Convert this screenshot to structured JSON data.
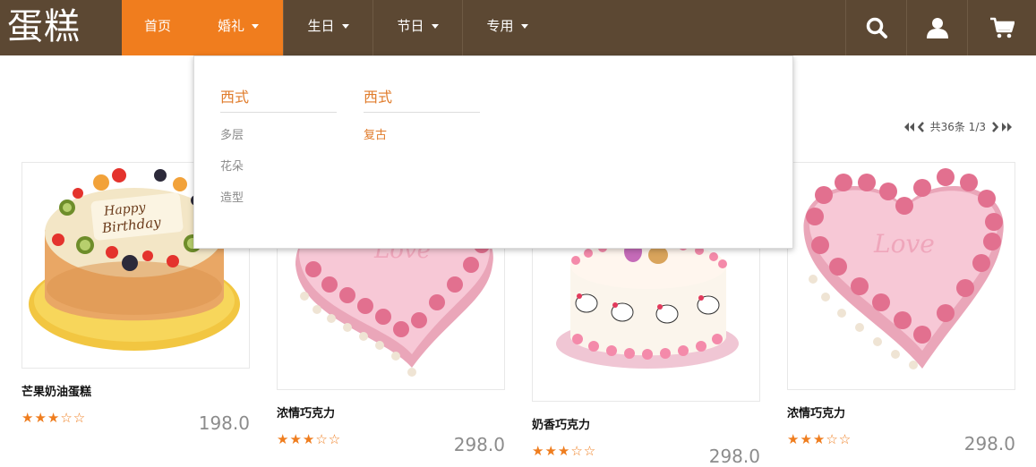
{
  "brand": {
    "logo": "蛋糕"
  },
  "nav": {
    "items": [
      {
        "label": "首页"
      },
      {
        "label": "婚礼"
      },
      {
        "label": "生日"
      },
      {
        "label": "节日"
      },
      {
        "label": "专用"
      }
    ],
    "icons": [
      "search-icon",
      "user-icon",
      "cart-icon"
    ]
  },
  "dropdown": {
    "columns": [
      {
        "heading": "西式",
        "items": [
          "多层",
          "花朵",
          "造型"
        ]
      },
      {
        "heading": "西式",
        "items": [
          "复古"
        ]
      }
    ]
  },
  "pager": {
    "text": "共36条 1/3"
  },
  "products": [
    {
      "name": "芒果奶油蛋糕",
      "price": "198.0",
      "rating": 3
    },
    {
      "name": "浓情巧克力",
      "price": "298.0",
      "rating": 3
    },
    {
      "name": "奶香巧克力",
      "price": "298.0",
      "rating": 3
    },
    {
      "name": "浓情巧克力",
      "price": "298.0",
      "rating": 3
    }
  ],
  "colors": {
    "nav_bg": "#5c4833",
    "accent": "#f07d1e",
    "price": "#8c8c8c"
  }
}
